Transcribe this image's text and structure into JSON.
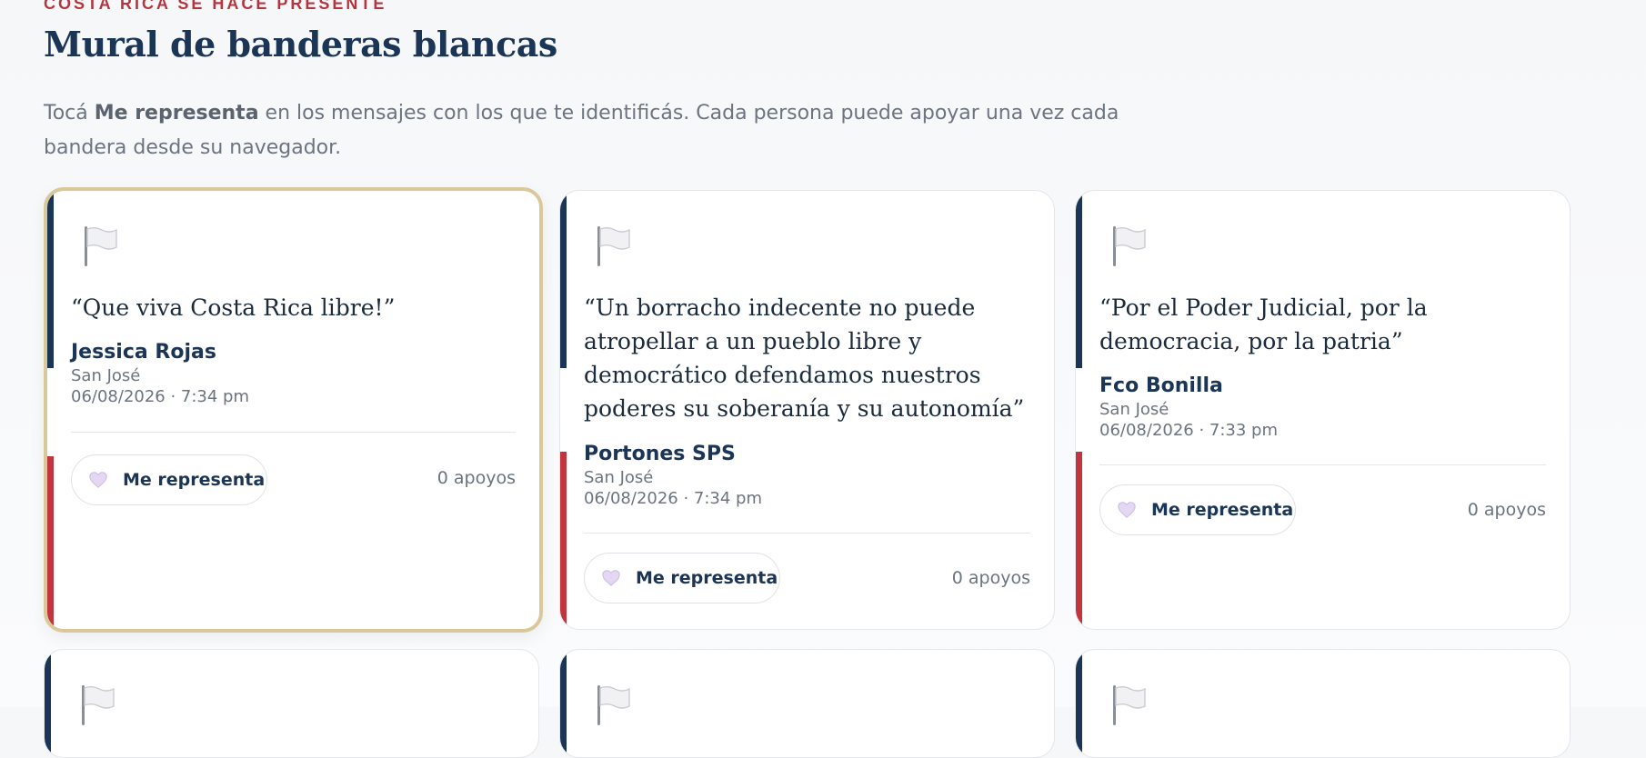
{
  "header": {
    "eyebrow": "COSTA RICA SE HACE PRESENTE",
    "title": "Mural de banderas blancas",
    "intro_pre": "Tocá ",
    "intro_bold": "Me representa",
    "intro_post": " en los mensajes con los que te identificás. Cada persona puede apoyar una vez cada bandera desde su navegador."
  },
  "colors": {
    "navy": "#1b3556",
    "red": "#c0353e",
    "gold": "#d9c99a"
  },
  "cards": [
    {
      "quote": "“Que viva Costa Rica libre!”",
      "author": "Jessica Rojas",
      "place": "San José",
      "date": "06/08/2026 · 7:34 pm",
      "button": "Me representa",
      "count": "0 apoyos",
      "icon": "white-flag-icon"
    },
    {
      "quote": "“Un borracho indecente no puede atropellar a un pueblo libre y democrático defendamos nuestros poderes su soberanía y su autonomía”",
      "author": "Portones SPS",
      "place": "San José",
      "date": "06/08/2026 · 7:34 pm",
      "button": "Me representa",
      "count": "0 apoyos",
      "icon": "white-flag-icon"
    },
    {
      "quote": "“Por el Poder Judicial, por la democracia, por la patria”",
      "author": "Fco Bonilla",
      "place": "San José",
      "date": "06/08/2026 · 7:33 pm",
      "button": "Me representa",
      "count": "0 apoyos",
      "icon": "white-flag-icon"
    }
  ]
}
